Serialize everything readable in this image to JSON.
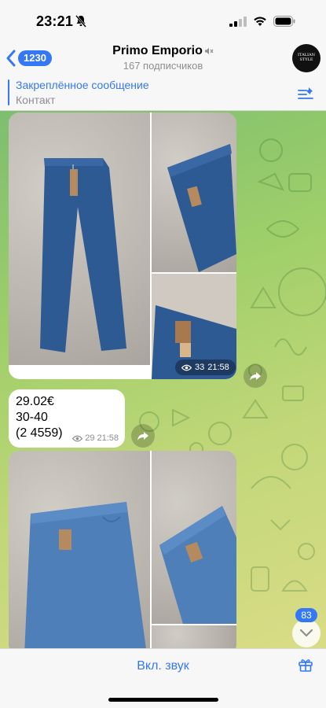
{
  "status_bar": {
    "time": "23:21"
  },
  "header": {
    "back_count": "1230",
    "channel_name": "Primo Emporio",
    "subscribers": "167 подписчиков",
    "avatar_text": [
      "ITALIAN",
      "STYLE"
    ]
  },
  "pinned": {
    "title": "Закреплённое сообщение",
    "subtitle": "Контакт"
  },
  "messages": [
    {
      "type": "album",
      "views": "33",
      "time": "21:58"
    },
    {
      "type": "text",
      "lines": [
        "29.02€",
        "30-40",
        "(2 4559)"
      ],
      "views": "29",
      "time": "21:58"
    },
    {
      "type": "album"
    }
  ],
  "scroll": {
    "unread_count": "83"
  },
  "bottom_bar": {
    "mute_label": "Вкл. звук"
  },
  "colors": {
    "accent": "#3478f6",
    "denim_dark": "#2e5a94",
    "denim_light": "#4f7fb9"
  }
}
